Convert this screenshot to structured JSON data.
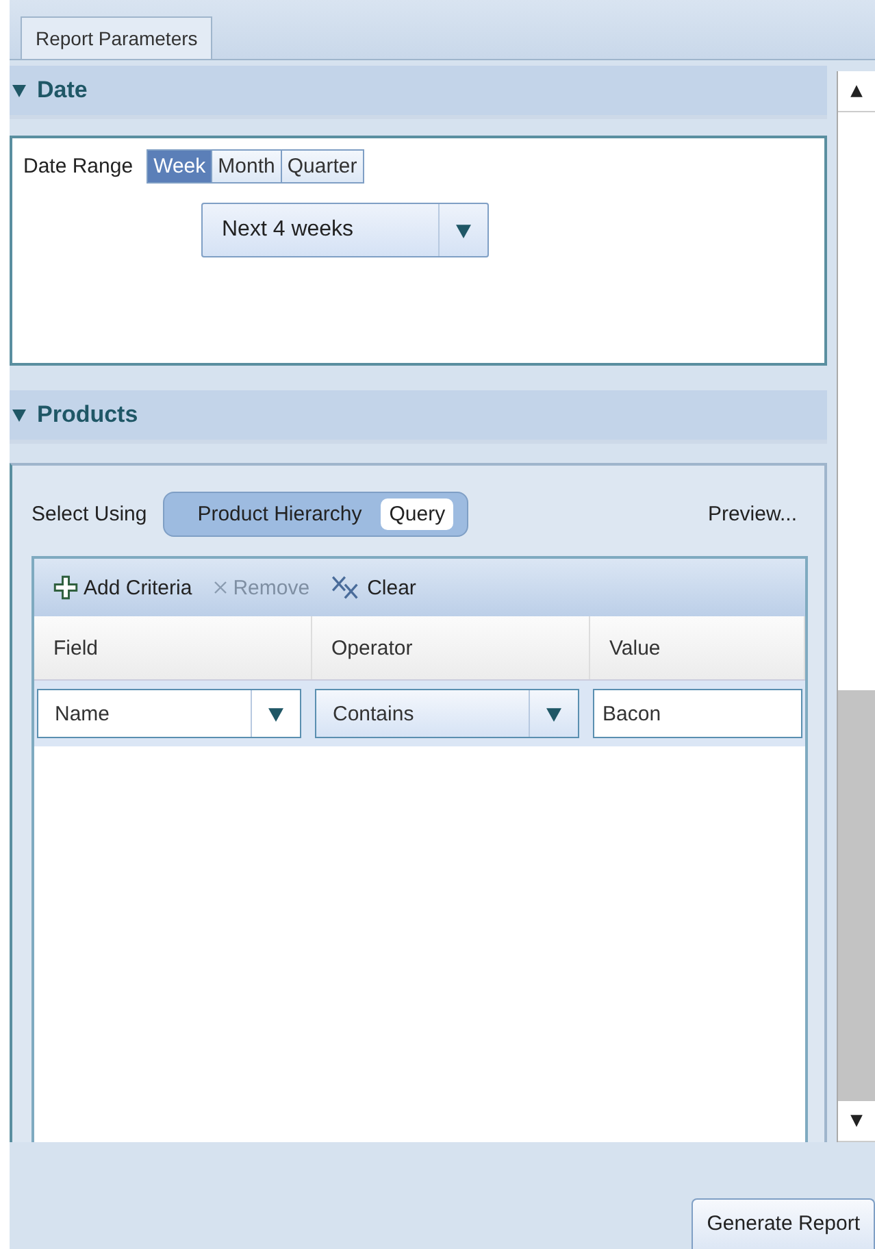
{
  "tabs": [
    {
      "label": "Report Parameters",
      "selected": true
    }
  ],
  "date_section": {
    "title": "Date",
    "expanded": true,
    "label": "Date Range",
    "range_options": [
      {
        "label": "Week",
        "selected": true
      },
      {
        "label": "Month",
        "selected": false
      },
      {
        "label": "Quarter",
        "selected": false
      }
    ],
    "period": {
      "value": "Next 4 weeks"
    }
  },
  "products_section": {
    "title": "Products",
    "expanded": true,
    "select_label": "Select Using",
    "select_options": [
      {
        "label": "Product Hierarchy",
        "selected": false
      },
      {
        "label": "Query",
        "selected": true
      }
    ],
    "preview_link": "Preview...",
    "toolbar": [
      {
        "kind": "add",
        "label": "Add Criteria",
        "disabled": false
      },
      {
        "kind": "remove",
        "label": "Remove",
        "disabled": true
      },
      {
        "kind": "clear",
        "label": "Clear",
        "disabled": false
      }
    ],
    "columns": [
      "Field",
      "Operator",
      "Value"
    ],
    "rows": [
      {
        "field": "Name",
        "operator": "Contains",
        "value": "Bacon"
      }
    ]
  },
  "generate_button": "Generate Report"
}
